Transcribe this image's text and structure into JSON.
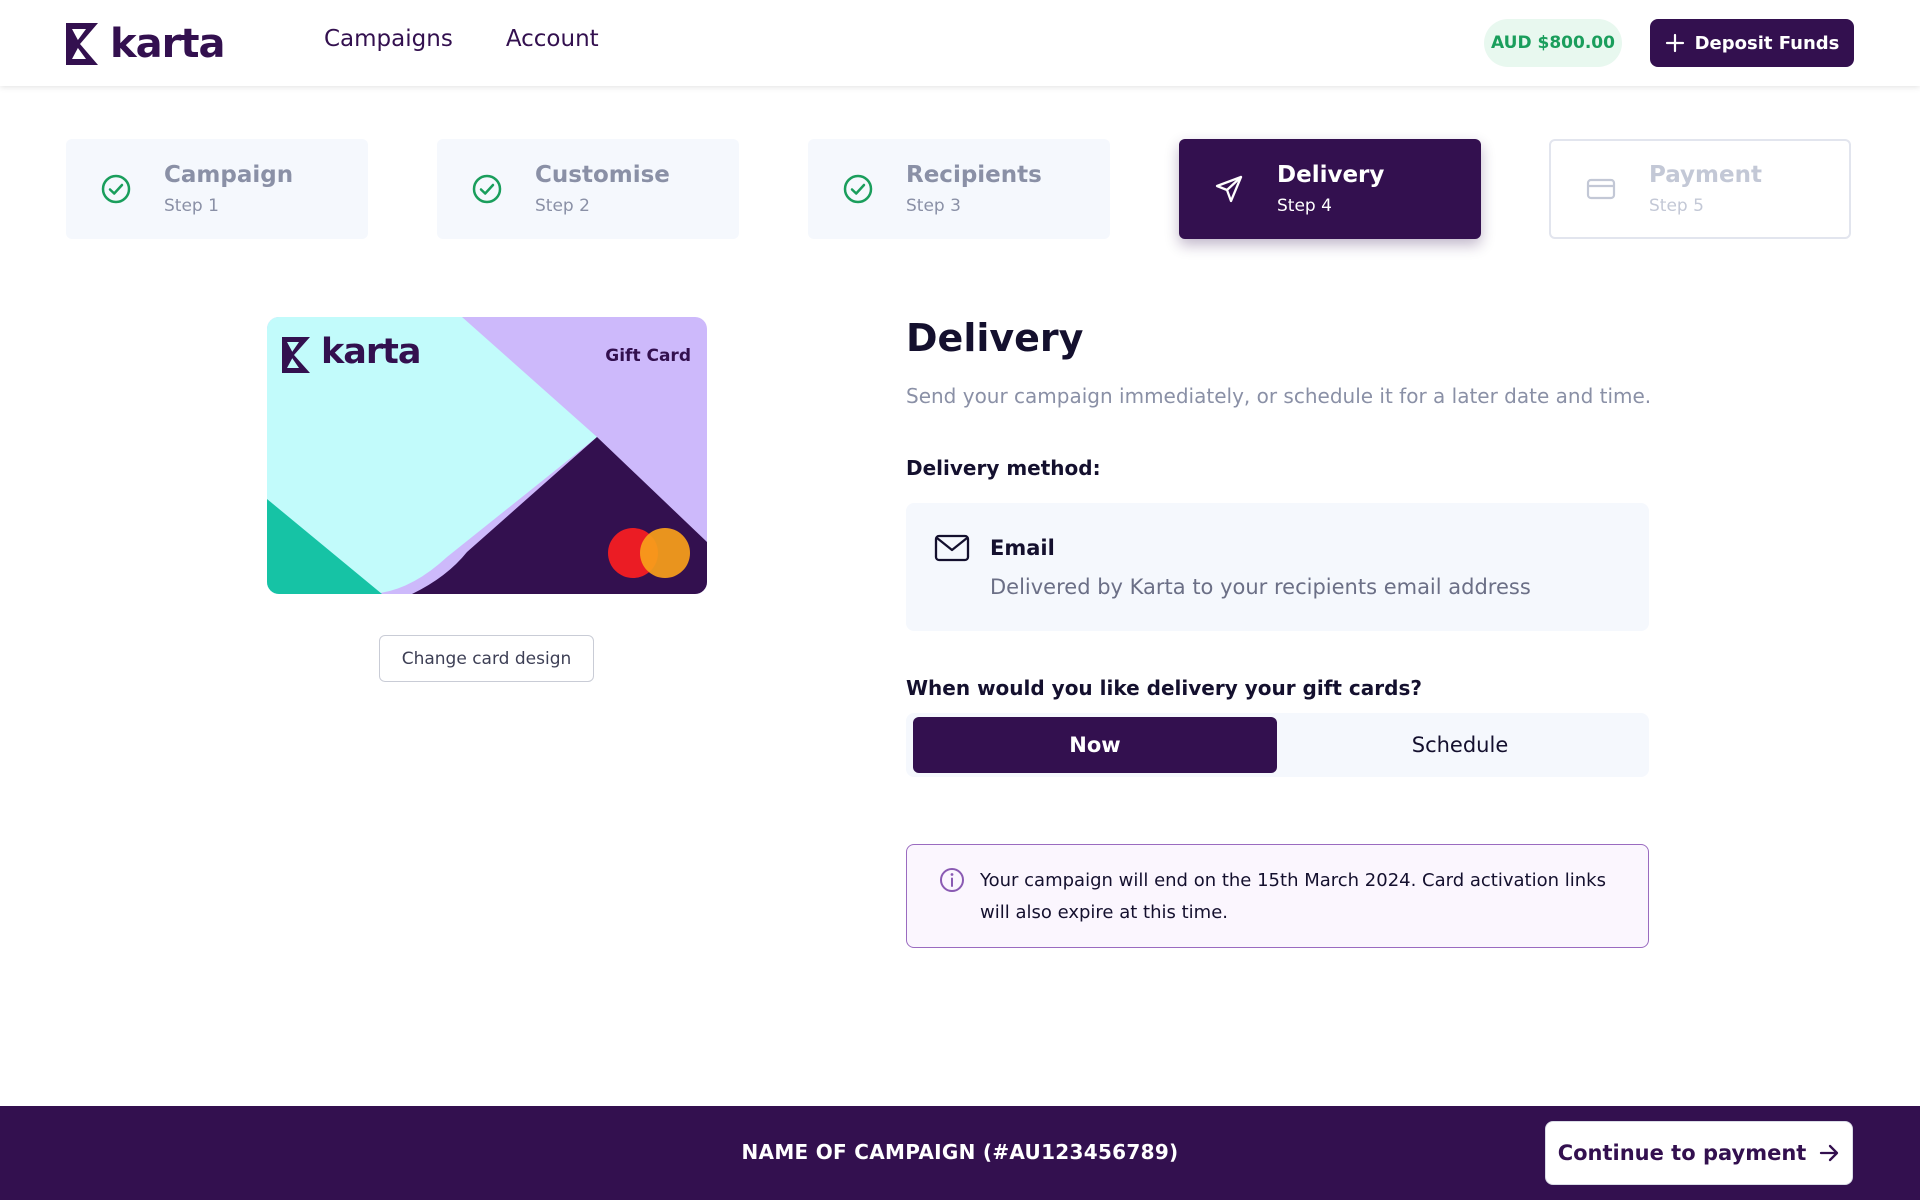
{
  "header": {
    "logo_text": "karta",
    "nav": [
      "Campaigns",
      "Account"
    ],
    "balance": "AUD $800.00",
    "deposit_label": "Deposit Funds"
  },
  "steps": [
    {
      "title": "Campaign",
      "sub": "Step 1",
      "state": "done",
      "icon": "check-circle-icon"
    },
    {
      "title": "Customise",
      "sub": "Step 2",
      "state": "done",
      "icon": "check-circle-icon"
    },
    {
      "title": "Recipients",
      "sub": "Step 3",
      "state": "done",
      "icon": "check-circle-icon"
    },
    {
      "title": "Delivery",
      "sub": "Step 4",
      "state": "active",
      "icon": "send-icon"
    },
    {
      "title": "Payment",
      "sub": "Step 5",
      "state": "disabled",
      "icon": "credit-card-icon"
    }
  ],
  "card": {
    "logo_text": "karta",
    "label": "Gift Card",
    "change_label": "Change card design"
  },
  "delivery": {
    "title": "Delivery",
    "subtitle": "Send your campaign immediately, or schedule it for a later date and time.",
    "method_label": "Delivery method:",
    "method_title": "Email",
    "method_desc": "Delivered by Karta to your recipients email address",
    "when_label": "When would you like delivery your gift cards?",
    "options": [
      "Now",
      "Schedule"
    ],
    "selected": "Now",
    "info": "Your campaign will end on the 15th March 2024. Card activation links will also expire at this time."
  },
  "footer": {
    "campaign_name": "NAME OF CAMPAIGN (#AU123456789)",
    "continue_label": "Continue to payment"
  },
  "colors": {
    "brand": "#33104f",
    "success": "#1a9e5c",
    "card_mint": "#c2fbfb",
    "card_lilac": "#cdb9fb",
    "card_teal": "#16c3a5"
  }
}
